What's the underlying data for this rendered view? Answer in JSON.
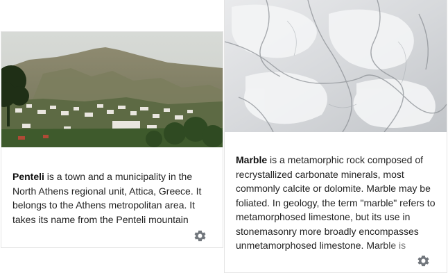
{
  "cards": [
    {
      "term": "Penteli",
      "extract": " is a town and a municipality in the North Athens regional unit, Attica, Greece. It belongs to the Athens metropolitan area. It takes its name from the Penteli mountain",
      "image_alt": "Penteli",
      "settings_icon": "gear-icon"
    },
    {
      "term": "Marble",
      "extract": " is a metamorphic rock composed of recrystallized carbonate minerals, most commonly calcite or dolomite. Marble may be foliated. In geology, the term \"marble\" refers to metamorphosed limestone, but its use in stonemasonry more broadly encompasses unmetamorphosed limestone. Marble is",
      "image_alt": "Marble",
      "settings_icon": "gear-icon"
    }
  ],
  "colors": {
    "text": "#222222",
    "icon": "#72777d",
    "border": "#e4e4e4"
  }
}
